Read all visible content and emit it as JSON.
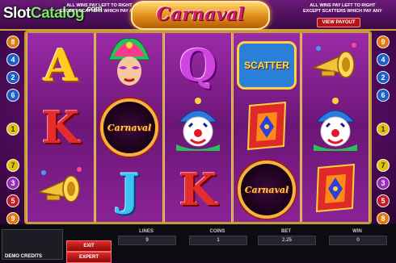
{
  "header": {
    "logo": {
      "part1": "Slot",
      "part2": "Catalog",
      "suffix": ".com"
    },
    "title": "Carnaval",
    "info_left": [
      "ALL WINS PAY LEFT TO RIGHT",
      "EXCEPT SCATTERS WHICH PAY ANY"
    ],
    "info_right": [
      "ALL WINS PAY LEFT TO RIGHT",
      "EXCEPT SCATTERS WHICH PAY ANY"
    ],
    "view_payout": "VIEW PAYOUT"
  },
  "reels": [
    [
      {
        "symbol": "letter-a",
        "text": "A"
      },
      {
        "symbol": "letter-k",
        "text": "K"
      },
      {
        "symbol": "trumpet",
        "text": ""
      }
    ],
    [
      {
        "symbol": "carnival-woman",
        "text": ""
      },
      {
        "symbol": "carnaval-wild",
        "text": "Carnaval"
      },
      {
        "symbol": "letter-j",
        "text": "J"
      }
    ],
    [
      {
        "symbol": "letter-q",
        "text": "Q"
      },
      {
        "symbol": "clown",
        "text": ""
      },
      {
        "symbol": "letter-k",
        "text": "K"
      }
    ],
    [
      {
        "symbol": "scatter",
        "text": "SCATTER"
      },
      {
        "symbol": "harlequin-flag",
        "text": ""
      },
      {
        "symbol": "carnaval-wild",
        "text": "Carnaval"
      }
    ],
    [
      {
        "symbol": "trumpet",
        "text": ""
      },
      {
        "symbol": "clown",
        "text": ""
      },
      {
        "symbol": "harlequin-flag",
        "text": ""
      }
    ]
  ],
  "paylines": {
    "left": [
      {
        "n": "8",
        "color": "orange"
      },
      {
        "n": "4",
        "color": "blue"
      },
      {
        "n": "2",
        "color": "blue"
      },
      {
        "n": "6",
        "color": "blue"
      },
      {
        "n": "1",
        "color": "yellow"
      },
      {
        "n": "7",
        "color": "yellow"
      },
      {
        "n": "3",
        "color": "purple"
      },
      {
        "n": "5",
        "color": "red"
      },
      {
        "n": "9",
        "color": "orange"
      }
    ],
    "right": [
      {
        "n": "9",
        "color": "orange"
      },
      {
        "n": "4",
        "color": "blue"
      },
      {
        "n": "2",
        "color": "blue"
      },
      {
        "n": "6",
        "color": "blue"
      },
      {
        "n": "1",
        "color": "yellow"
      },
      {
        "n": "7",
        "color": "yellow"
      },
      {
        "n": "3",
        "color": "purple"
      },
      {
        "n": "5",
        "color": "red"
      },
      {
        "n": "8",
        "color": "orange"
      }
    ]
  },
  "controls": {
    "credits_label": "DEMO CREDITS",
    "exit": "EXIT",
    "expert": "EXPERT",
    "lines_label": "LINES",
    "lines_value": "9",
    "coins_label": "COINS",
    "coins_value": "1",
    "bet_label": "BET",
    "bet_value": "2.25",
    "win_label": "WIN",
    "win_value": "0"
  }
}
